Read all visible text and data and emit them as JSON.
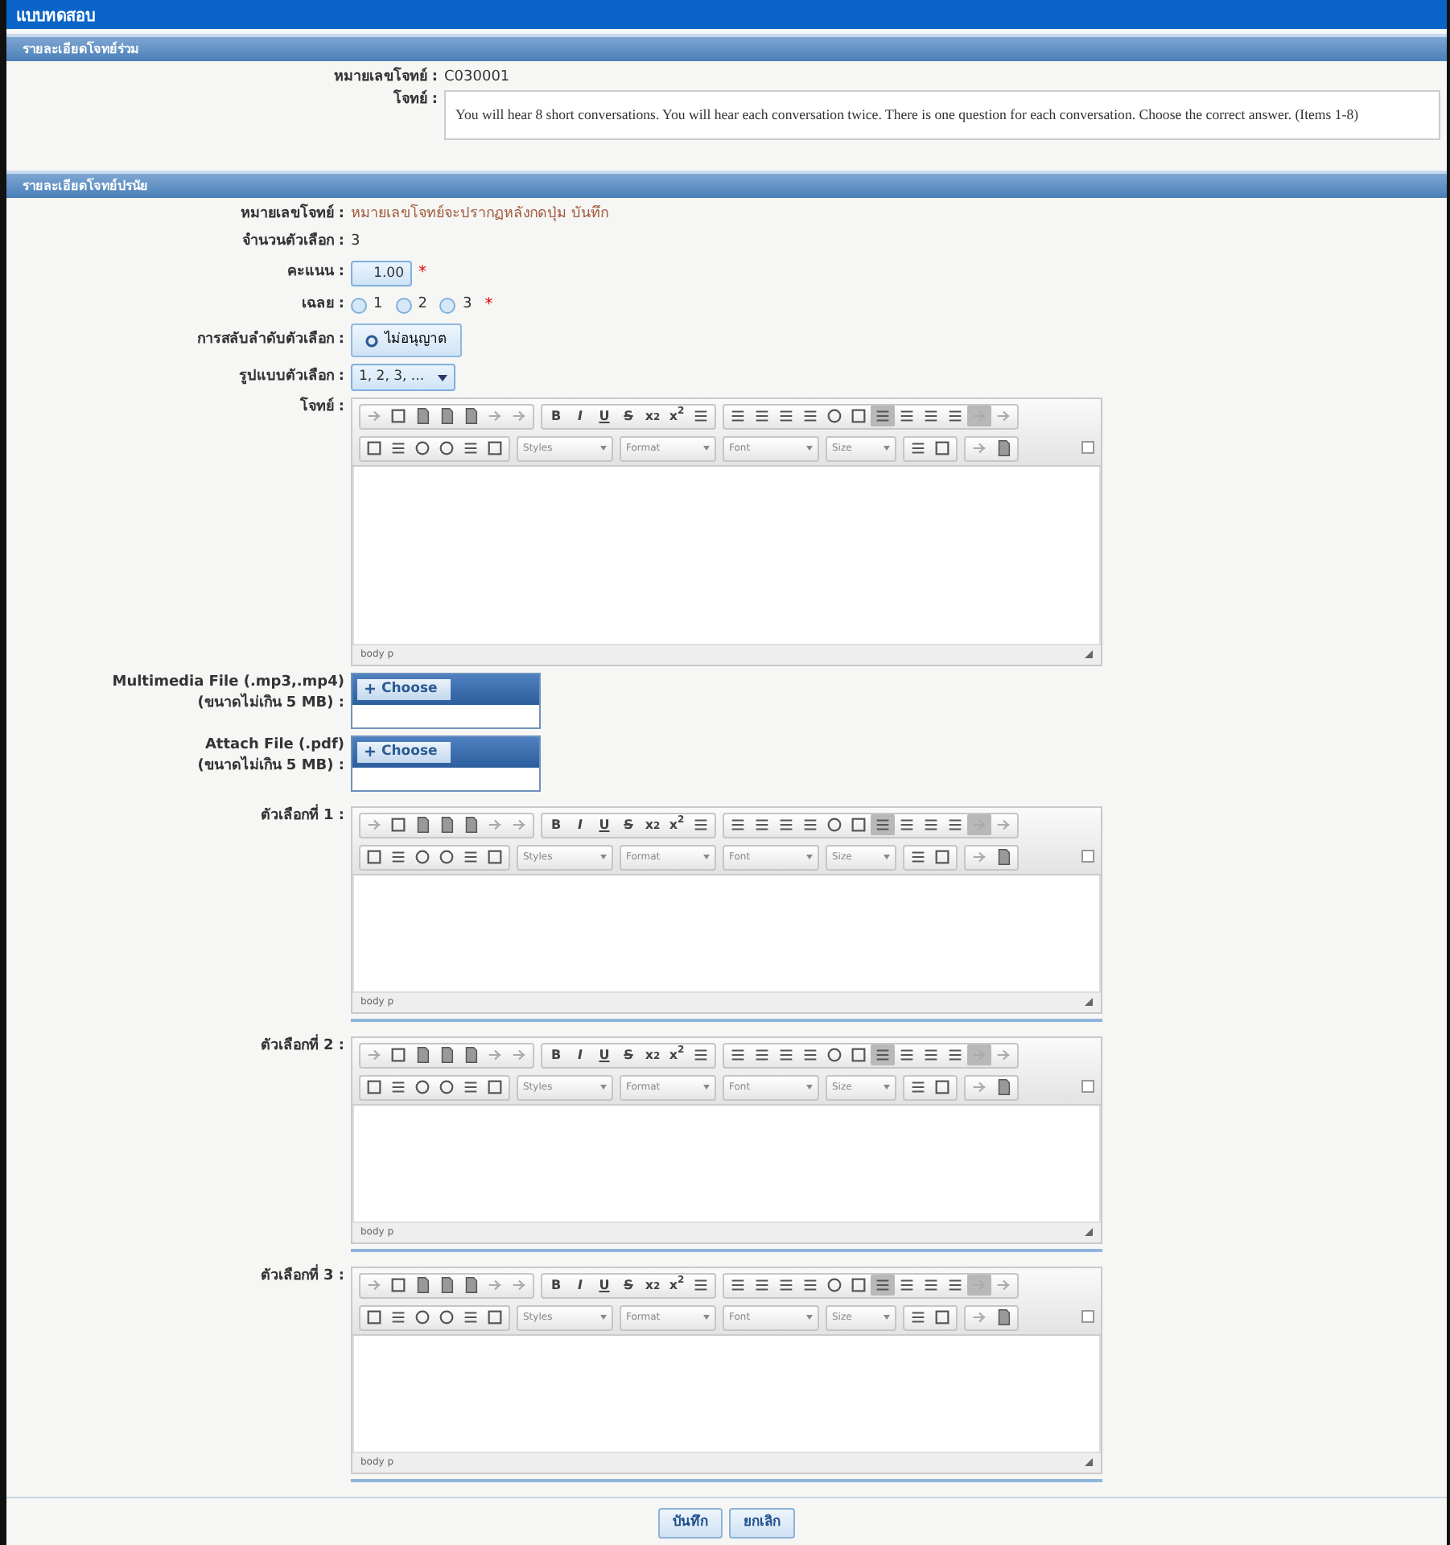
{
  "window": {
    "title": "แบบทดสอบ"
  },
  "common_section": {
    "title": "รายละเอียดโจทย์ร่วม",
    "number": {
      "label": "หมายเลขโจทย์ :",
      "value": "C030001"
    },
    "question": {
      "label": "โจทย์ :",
      "text": "You will hear 8 short conversations.  You will hear each conversation twice.  There is one question for each conversation. Choose the correct answer. (Items 1-8)"
    }
  },
  "item_section": {
    "title": "รายละเอียดโจทย์ปรนัย",
    "number": {
      "label": "หมายเลขโจทย์ :",
      "value": "หมายเลขโจทย์จะปรากฏหลังกดปุ่ม บันทึก"
    },
    "choice_count": {
      "label": "จำนวนตัวเลือก :",
      "value": "3"
    },
    "score": {
      "label": "คะแนน :",
      "value": "1.00",
      "required_mark": "*"
    },
    "answer": {
      "label": "เฉลย :",
      "required_mark": "*",
      "options": [
        {
          "label": "1",
          "selected": false
        },
        {
          "label": "2",
          "selected": false
        },
        {
          "label": "3",
          "selected": false
        }
      ]
    },
    "shuffle": {
      "label": "การสลับลำดับตัวเลือก :",
      "button": "ไม่อนุญาต"
    },
    "choice_format": {
      "label": "รูปแบบตัวเลือก :",
      "value": "1, 2, 3, ..."
    },
    "question_editor": {
      "label": "โจทย์ :",
      "marks": [
        "B",
        "I",
        "U",
        "S",
        "x$_{2}$",
        "x$^{2}$"
      ],
      "combos": [
        "Styles",
        "Format",
        "Font",
        "Size"
      ],
      "pressed": {
        "align_left": true,
        "ltr": true
      },
      "path": "body p"
    },
    "uploads": [
      {
        "label": "Multimedia File (.mp3,.mp4)",
        "note": "(ขนาดไม่เกิน 5 MB) :",
        "button": "Choose"
      },
      {
        "label": "Attach File (.pdf)",
        "note": "(ขนาดไม่เกิน 5 MB) :",
        "button": "Choose"
      }
    ],
    "choices": [
      {
        "label": "ตัวเลือกที่ 1 :",
        "marks": [
          "B",
          "I",
          "U",
          "S",
          "x$_{2}$",
          "x$^{2}$"
        ],
        "combos": [
          "Styles",
          "Format",
          "Font",
          "Size"
        ],
        "pressed": {
          "align_left": true,
          "ltr": true
        },
        "path": "body p"
      },
      {
        "label": "ตัวเลือกที่ 2 :",
        "marks": [
          "B",
          "I",
          "U",
          "S",
          "x$_{2}$",
          "x$^{2}$"
        ],
        "combos": [
          "Styles",
          "Format",
          "Font",
          "Size"
        ],
        "pressed": {
          "align_left": true,
          "ltr": true
        },
        "path": "body p"
      },
      {
        "label": "ตัวเลือกที่ 3 :",
        "marks": [
          "B",
          "I",
          "U",
          "S",
          "x$_{2}$",
          "x$^{2}$"
        ],
        "combos": [
          "Styles",
          "Format",
          "Font",
          "Size"
        ],
        "pressed": {
          "align_left": true,
          "ltr": true
        },
        "path": "body p"
      }
    ]
  },
  "actions": [
    {
      "label": "บันทึก"
    },
    {
      "label": "ยกเลิก"
    }
  ]
}
